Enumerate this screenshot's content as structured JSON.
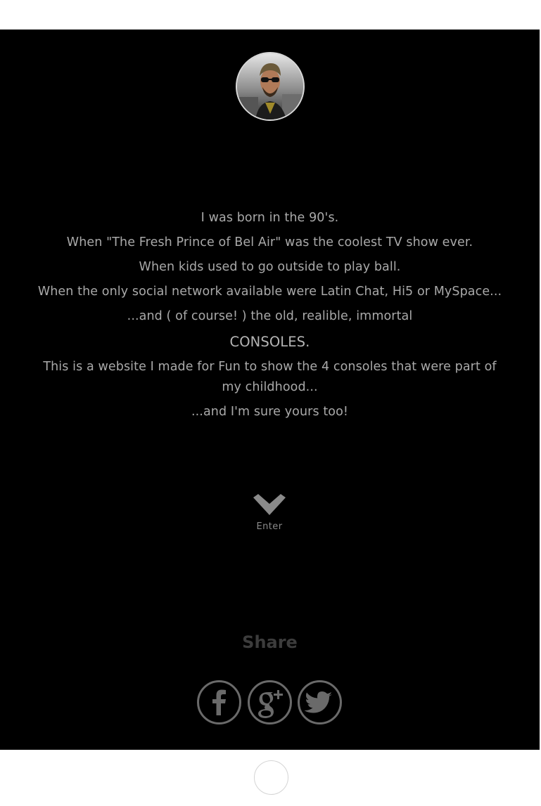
{
  "intro": {
    "lines": [
      "I was born in the 90's.",
      "When \"The Fresh Prince of Bel Air\" was the coolest TV show ever.",
      "When kids used to go outside to play ball.",
      "When the only social network available were Latin Chat, Hi5 or MySpace...",
      "...and ( of course! ) the old, realible, immortal"
    ],
    "consoles": "CONSOLES.",
    "website_note": "This is a website I made for Fun to show the 4 consoles that were part of my childhood...",
    "closing": "...and I'm sure yours too!"
  },
  "enter": {
    "label": "Enter",
    "icon": "chevron-down-icon"
  },
  "share": {
    "title": "Share",
    "buttons": [
      {
        "name": "facebook",
        "icon": "facebook-icon"
      },
      {
        "name": "google-plus",
        "icon": "google-plus-icon"
      },
      {
        "name": "twitter",
        "icon": "twitter-icon"
      }
    ]
  },
  "colors": {
    "hero_background": "#000000",
    "text": "#a9a9a9",
    "share_title": "#3c3c3c",
    "icon_stroke": "#6a6a6a",
    "page_background": "#ffffff"
  }
}
